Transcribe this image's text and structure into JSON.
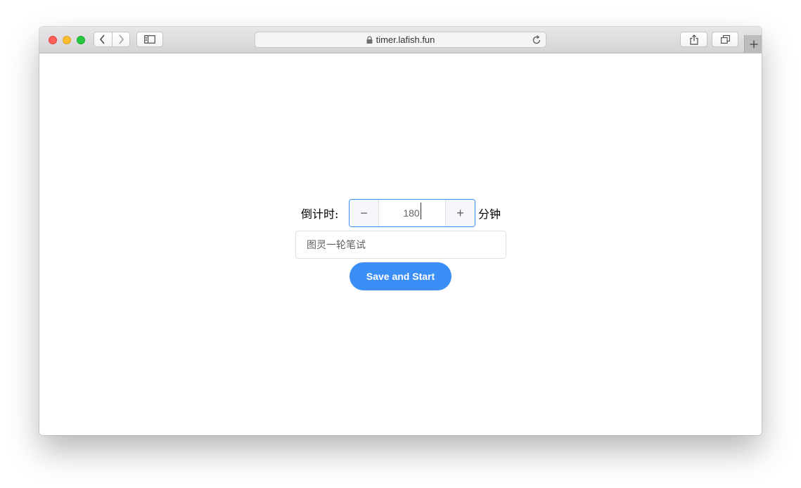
{
  "browser": {
    "url": "timer.lafish.fun",
    "icons": {
      "close": "close-dot",
      "minimize": "minimize-dot",
      "maximize": "maximize-dot",
      "back": "chevron-left-icon",
      "forward": "chevron-right-icon",
      "sidebar": "sidebar-icon",
      "lock": "lock-icon",
      "reload": "reload-icon",
      "share": "share-icon",
      "tabs": "tabs-icon",
      "new_tab": "plus-icon"
    }
  },
  "timer": {
    "label": "倒计时:",
    "minus_symbol": "−",
    "value": "180",
    "plus_symbol": "+",
    "unit": "分钟"
  },
  "title_field": {
    "value": "图灵一轮笔试"
  },
  "actions": {
    "start_label": "Save and Start"
  },
  "colors": {
    "accent": "#3a8ef6",
    "stepper_border": "#3b8ff6",
    "close": "#fe5f57",
    "minimize": "#febc2e",
    "maximize": "#28c840"
  }
}
